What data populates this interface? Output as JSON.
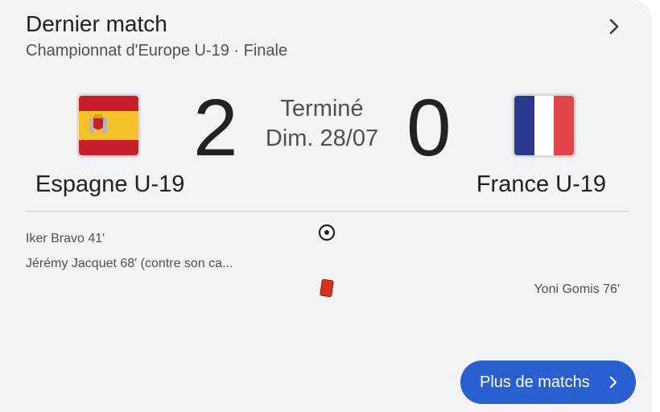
{
  "header": {
    "title": "Dernier match",
    "subtitle": "Championnat d'Europe U-19 · Finale"
  },
  "match": {
    "status": "Terminé",
    "date": "Dim. 28/07",
    "home": {
      "name": "Espagne U-19",
      "score": "2",
      "flag": "spain-flag-icon"
    },
    "away": {
      "name": "France U-19",
      "score": "0",
      "flag": "france-flag-icon"
    }
  },
  "events": [
    {
      "text": "Iker Bravo 41'",
      "team": "home"
    },
    {
      "text": "Jérémy Jacquet 68' (contre son ca...",
      "team": "home"
    },
    {
      "text": "Yoni Gomis 76'",
      "team": "away"
    }
  ],
  "icons": {
    "goal": "soccer-ball-icon",
    "red_card": "red-card-icon"
  },
  "footer": {
    "more_label": "Plus de matchs"
  },
  "colors": {
    "card_background": "#f1f3f4",
    "button": "#2a5fd0",
    "red_card": "#d93025",
    "france_blue": "#2a3a8f",
    "france_red": "#e0454a",
    "spain_red": "#c8202a",
    "spain_yellow": "#f6c12d"
  }
}
